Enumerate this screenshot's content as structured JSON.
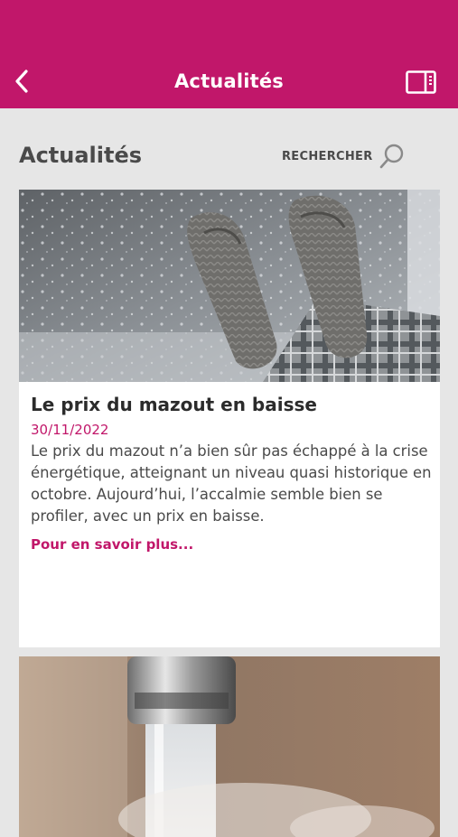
{
  "header": {
    "title": "Actualités",
    "back_icon": "chevron-left-icon",
    "sidebar_icon": "sidebar-panel-icon",
    "background_color": "#c1176a"
  },
  "page": {
    "heading": "Actualités",
    "search_label": "RECHERCHER",
    "search_icon": "search-icon"
  },
  "articles": [
    {
      "image_icon": "socks-window-photo",
      "title": "Le prix du mazout en baisse",
      "date": "30/11/2022",
      "excerpt": "Le prix du mazout n’a bien sûr pas échappé à la crise énergétique, atteignant un niveau quasi historique en octobre. Aujourd’hui, l’accalmie semble bien se profiler, avec un prix en baisse.",
      "link_label": "Pour en savoir plus..."
    },
    {
      "image_icon": "faucet-water-photo"
    }
  ],
  "colors": {
    "accent": "#c1176a",
    "background": "#e6e6e6",
    "text": "#4a4a4a"
  }
}
